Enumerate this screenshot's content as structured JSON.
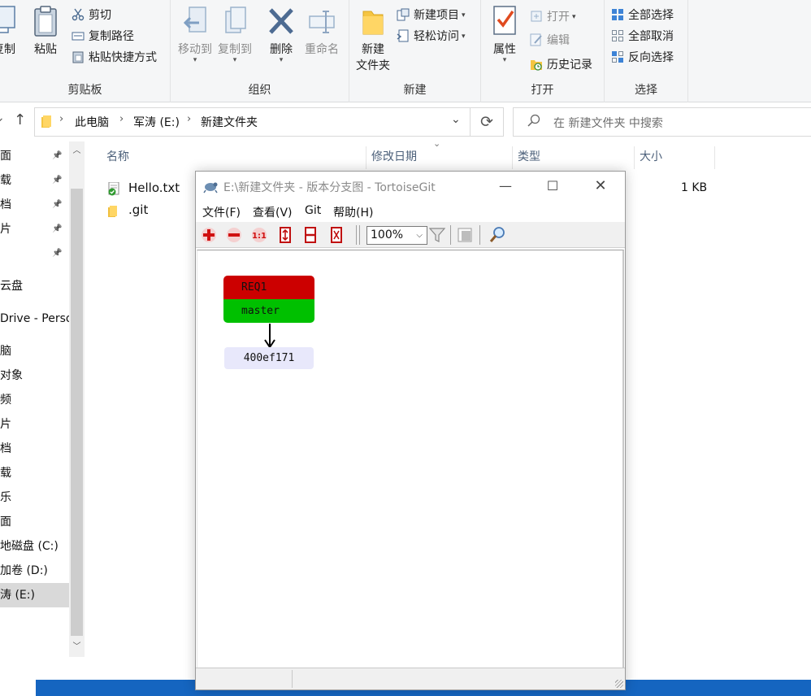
{
  "ribbon": {
    "clipboard": {
      "copy_label": "复制",
      "paste_label": "粘贴",
      "cut_label": "剪切",
      "copy_path_label": "复制路径",
      "paste_shortcut_label": "粘贴快捷方式",
      "group_label": "剪贴板"
    },
    "organize": {
      "move_to_label": "移动到",
      "copy_to_label": "复制到",
      "delete_label": "删除",
      "rename_label": "重命名",
      "group_label": "组织"
    },
    "new": {
      "new_folder_label_line1": "新建",
      "new_folder_label_line2": "文件夹",
      "new_item_label": "新建项目",
      "easy_access_label": "轻松访问",
      "group_label": "新建"
    },
    "open": {
      "properties_label": "属性",
      "open_label": "打开",
      "edit_label": "编辑",
      "history_label": "历史记录",
      "group_label": "打开"
    },
    "select": {
      "select_all_label": "全部选择",
      "select_none_label": "全部取消",
      "invert_selection_label": "反向选择",
      "group_label": "选择"
    }
  },
  "address": {
    "crumbs": [
      "此电脑",
      "军涛 (E:)",
      "新建文件夹"
    ],
    "search_placeholder": "在 新建文件夹 中搜索"
  },
  "nav": {
    "items": [
      {
        "label": "面",
        "pinned": true
      },
      {
        "label": "载",
        "pinned": true
      },
      {
        "label": "档",
        "pinned": true
      },
      {
        "label": "片",
        "pinned": true
      },
      {
        "label": "",
        "pinned": true
      },
      {
        "label": "云盘",
        "pinned": false
      },
      {
        "label": "Drive - Perso",
        "pinned": false
      },
      {
        "label": "脑",
        "pinned": false
      },
      {
        "label": "对象",
        "pinned": false
      },
      {
        "label": "频",
        "pinned": false
      },
      {
        "label": "片",
        "pinned": false
      },
      {
        "label": "档",
        "pinned": false
      },
      {
        "label": "载",
        "pinned": false
      },
      {
        "label": "乐",
        "pinned": false
      },
      {
        "label": "面",
        "pinned": false
      },
      {
        "label": "地磁盘 (C:)",
        "pinned": false
      },
      {
        "label": "加卷 (D:)",
        "pinned": false
      },
      {
        "label": "涛 (E:)",
        "pinned": false,
        "selected": true
      }
    ]
  },
  "filelist": {
    "columns": {
      "name": "名称",
      "modified": "修改日期",
      "type": "类型",
      "size": "大小"
    },
    "rows": [
      {
        "name": "Hello.txt",
        "size": "1 KB",
        "icon": "git-clean-text-file-icon"
      },
      {
        "name": ".git",
        "size": "",
        "icon": "folder-icon"
      }
    ]
  },
  "tortoisegit": {
    "title": "E:\\新建文件夹 - 版本分支图 - TortoiseGit",
    "menu": [
      "文件(F)",
      "查看(V)",
      "Git",
      "帮助(H)"
    ],
    "zoom": "100%",
    "graph": {
      "refs": [
        {
          "label": "REQ1",
          "color": "#cc0000"
        },
        {
          "label": "master",
          "color": "#00c000"
        }
      ],
      "commit": "400ef171",
      "commit_color": "#e8e8fb"
    }
  },
  "colors": {
    "accent": "#0078d7",
    "ribbon_bg": "#f5f6f7",
    "selection": "#d9d9d9",
    "taskbar": "#1565c0"
  }
}
